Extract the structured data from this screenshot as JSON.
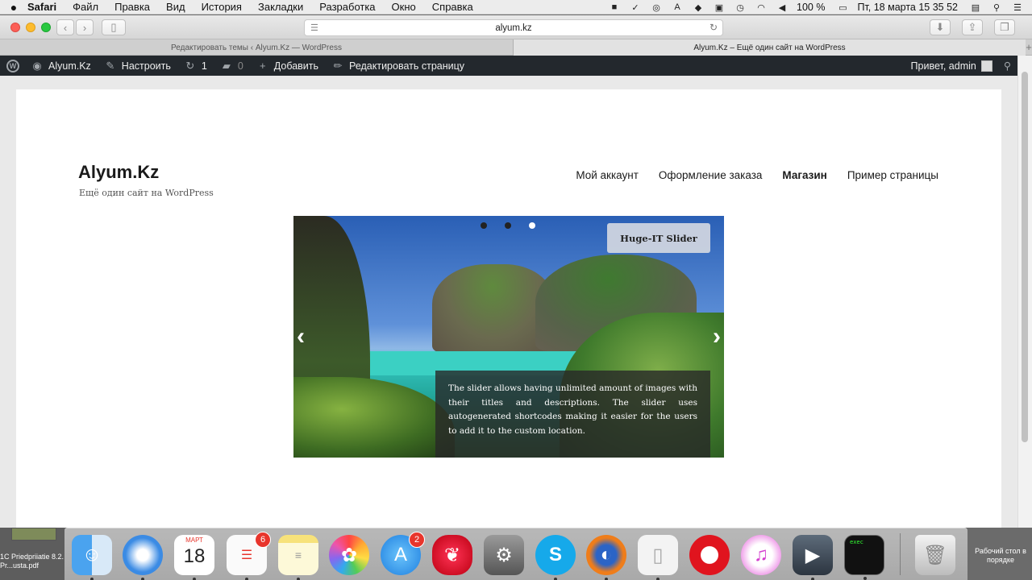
{
  "menubar": {
    "app": "Safari",
    "items": [
      "Файл",
      "Правка",
      "Вид",
      "История",
      "Закладки",
      "Разработка",
      "Окно",
      "Справка"
    ],
    "battery": "100 %",
    "datetime": "Пт, 18 марта  15 35 52"
  },
  "browser": {
    "url": "alyum.kz",
    "tabs": [
      "Редактировать темы ‹ Alyum.Kz — WordPress",
      "Alyum.Kz – Ещё один сайт на WordPress"
    ]
  },
  "adminbar": {
    "site": "Alyum.Kz",
    "customize": "Настроить",
    "updates": "1",
    "comments": "0",
    "add": "Добавить",
    "edit": "Редактировать страницу",
    "greeting": "Привет, admin"
  },
  "site": {
    "title": "Alyum.Kz",
    "description": "Ещё один сайт на WordPress",
    "nav": [
      "Мой аккаунт",
      "Оформление заказа",
      "Магазин",
      "Пример страницы"
    ]
  },
  "slider": {
    "title": "Huge-IT Slider",
    "description": "The slider allows having unlimited amount of images with their titles and descriptions. The slider uses autogenerated shortcodes making it easier for the users to add it to the custom location.",
    "slides": 3,
    "active_slide": 3
  },
  "dock": {
    "calendar_month": "МАРТ",
    "calendar_day": "18",
    "reminders_badge": "6",
    "appstore_badge": "2",
    "terminal_text": "exec",
    "left_label": "1C Priedpriiatie 8.2. Pr...usta.pdf",
    "right_label": "Рабочий стол в порядке"
  }
}
